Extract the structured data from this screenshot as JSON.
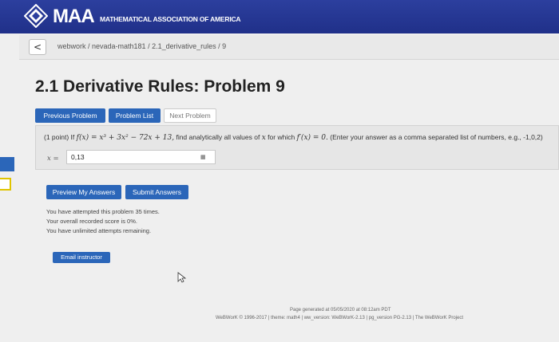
{
  "header": {
    "logo_text": "MAA",
    "org_name": "MATHEMATICAL ASSOCIATION OF AMERICA",
    "colors": {
      "header_bg": "#203089",
      "button_blue": "#2b66b9"
    }
  },
  "breadcrumb": {
    "back_icon": "chevron-left-icon",
    "back_label": "<",
    "path": "webwork / nevada-math181 / 2.1_derivative_rules / 9"
  },
  "page": {
    "title": "2.1 Derivative Rules: Problem 9"
  },
  "nav": {
    "previous": "Previous Problem",
    "list": "Problem List",
    "next": "Next Problem"
  },
  "problem": {
    "points": "(1 point) If",
    "function": "f(x) = x³ + 3x² − 72x + 13,",
    "instruction": "find analytically all values of",
    "var": "x",
    "for_which": "for which",
    "condition": "f′(x) = 0.",
    "format_hint": "(Enter your answer as a comma separated list of numbers, e.g., -1,0,2)",
    "answer_label": "x =",
    "answer_value": "0,13",
    "grid_icon": "grid-icon"
  },
  "actions": {
    "preview": "Preview My Answers",
    "submit": "Submit Answers"
  },
  "status": {
    "attempts": "You have attempted this problem 35 times.",
    "score": "Your overall recorded score is 0%.",
    "remaining": "You have unlimited attempts remaining."
  },
  "email": {
    "label": "Email instructor"
  },
  "footer": {
    "generated": "Page generated at 05/05/2020 at 08:12am PDT",
    "version": "WeBWorK © 1996-2017 | theme: math4 | ww_version: WeBWorK-2.13 | pg_version PG-2.13 | The WeBWorK Project"
  }
}
